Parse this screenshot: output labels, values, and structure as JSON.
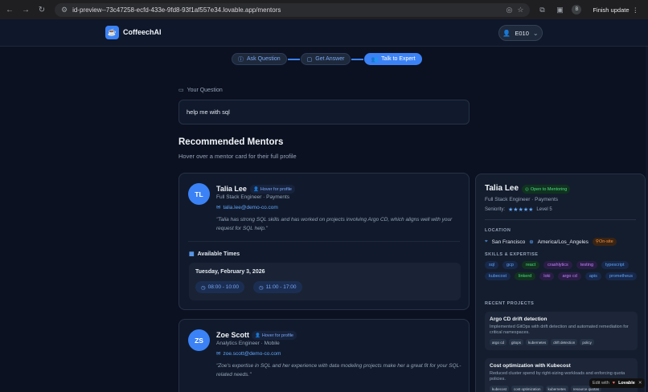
{
  "browser": {
    "url": "id-preview--73c47258-ecfd-433e-9fd8-93f1af557e34.lovable.app/mentors",
    "update_label": "Finish update",
    "profile_initial": "B"
  },
  "header": {
    "brand": "CoffeechAI",
    "user_label": "E010"
  },
  "steps": [
    {
      "label": "Ask Question",
      "state": "done"
    },
    {
      "label": "Get Answer",
      "state": "done"
    },
    {
      "label": "Talk to Expert",
      "state": "active"
    }
  ],
  "question": {
    "label": "Your Question",
    "value": "help me with sql"
  },
  "recommendations": {
    "title": "Recommended Mentors",
    "subtitle": "Hover over a mentor card for their full profile"
  },
  "mentors": [
    {
      "initials": "TL",
      "name": "Talia Lee",
      "hover_badge": "Hover for profile",
      "role": "Full Stack Engineer · Payments",
      "email": "talia.lee@demo-co.com",
      "quote": "\"Talia has strong SQL skills and has worked on projects involving Argo CD, which aligns well with your request for SQL help.\"",
      "available_label": "Available Times",
      "date": "Tuesday, February 3, 2026",
      "slots": [
        "08:00 - 10:00",
        "11:00 - 17:00"
      ]
    },
    {
      "initials": "ZS",
      "name": "Zoe Scott",
      "hover_badge": "Hover for profile",
      "role": "Analytics Engineer · Mobile",
      "email": "zoe.scott@demo-co.com",
      "quote": "\"Zoe's expertise in SQL and her experience with data modeling projects make her a great fit for your SQL-related needs.\""
    }
  ],
  "profile": {
    "name": "Talia Lee",
    "status_badge": "Open to Mentoring",
    "role": "Full Stack Engineer · Payments",
    "seniority_label": "Seniority:",
    "stars": "★★★★★",
    "level": "Level 5",
    "location_head": "LOCATION",
    "city": "San Francisco",
    "timezone": "America/Los_Angeles",
    "onsite": "On-site",
    "skills_head": "SKILLS & EXPERTISE",
    "skills": [
      {
        "name": "sql",
        "color": "#60a5fa",
        "bg": "#17284a"
      },
      {
        "name": "gcp",
        "color": "#60a5fa",
        "bg": "#17284a"
      },
      {
        "name": "react",
        "color": "#4ade80",
        "bg": "#12321f"
      },
      {
        "name": "crashlytics",
        "color": "#c084fc",
        "bg": "#2a1d45"
      },
      {
        "name": "testing",
        "color": "#c084fc",
        "bg": "#2a1d45"
      },
      {
        "name": "typescript",
        "color": "#60a5fa",
        "bg": "#17284a"
      },
      {
        "name": "kubecost",
        "color": "#60a5fa",
        "bg": "#17284a"
      },
      {
        "name": "linkerd",
        "color": "#4ade80",
        "bg": "#12321f"
      },
      {
        "name": "loki",
        "color": "#c084fc",
        "bg": "#2a1d45"
      },
      {
        "name": "argo cd",
        "color": "#c084fc",
        "bg": "#2a1d45"
      },
      {
        "name": "apis",
        "color": "#60a5fa",
        "bg": "#17284a"
      },
      {
        "name": "prometheus",
        "color": "#60a5fa",
        "bg": "#17284a"
      }
    ],
    "projects_head": "RECENT PROJECTS",
    "projects": [
      {
        "title": "Argo CD drift detection",
        "desc": "Implemented GitOps with drift detection and automated remediation for critical namespaces.",
        "tags": [
          "argo cd",
          "gitops",
          "kubernetes",
          "drift detection",
          "policy"
        ]
      },
      {
        "title": "Cost optimization with Kubecost",
        "desc": "Reduced cluster spend by right-sizing workloads and enforcing quota policies.",
        "tags": [
          "kubecost",
          "cost optimization",
          "kubernetes",
          "resource quotas"
        ]
      }
    ]
  },
  "lovable": {
    "prefix": "Edit with",
    "name": "Lovable"
  }
}
